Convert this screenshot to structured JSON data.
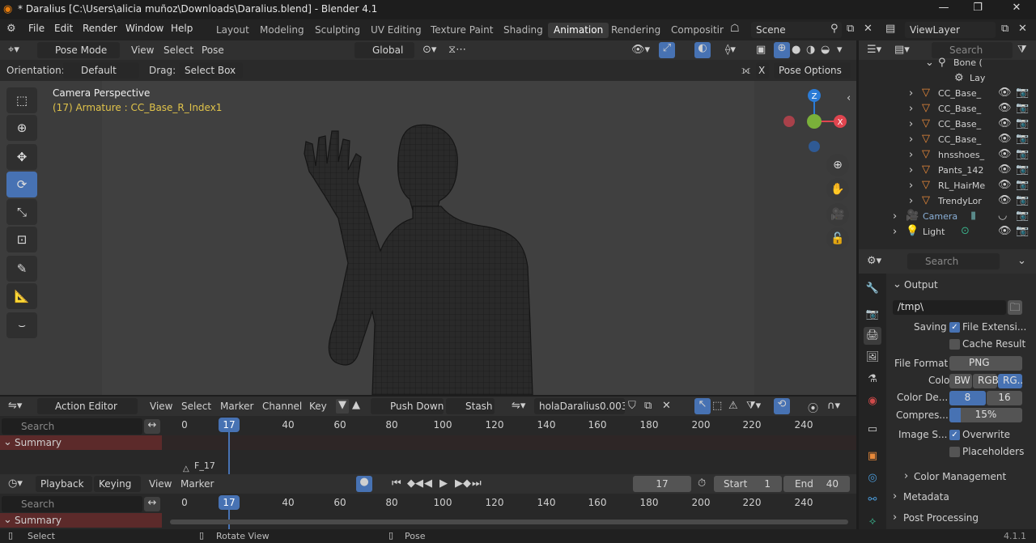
{
  "window": {
    "title": "* Daralius [C:\\Users\\alicia muñoz\\Downloads\\Daralius.blend] - Blender 4.1",
    "minimize": "—",
    "maximize": "❐",
    "close": "✕"
  },
  "menu": {
    "items": [
      "File",
      "Edit",
      "Render",
      "Window",
      "Help"
    ]
  },
  "workspaces": [
    "Layout",
    "Modeling",
    "Sculpting",
    "UV Editing",
    "Texture Paint",
    "Shading",
    "Animation",
    "Rendering",
    "Compositin"
  ],
  "active_workspace": "Animation",
  "scene": {
    "name": "Scene",
    "view_layer": "ViewLayer"
  },
  "viewport_header": {
    "mode": "Pose Mode",
    "view": "View",
    "select": "Select",
    "pose": "Pose",
    "transform": "Global"
  },
  "tool_header": {
    "orientation_label": "Orientation:",
    "orientation_value": "Default",
    "drag_label": "Drag:",
    "drag_value": "Select Box",
    "x_label": "X",
    "pose_options": "Pose Options"
  },
  "viewport": {
    "camera_label": "Camera Perspective",
    "armature_info": "(17) Armature : CC_Base_R_Index1"
  },
  "gizmo": {
    "z": "Z",
    "x": "X"
  },
  "outliner": {
    "search_placeholder": "Search",
    "items": [
      {
        "label": "Bone (",
        "kind": "bone"
      },
      {
        "label": "Lay",
        "kind": "layer"
      },
      {
        "label": "CC_Base_",
        "kind": "mesh"
      },
      {
        "label": "CC_Base_",
        "kind": "mesh"
      },
      {
        "label": "CC_Base_",
        "kind": "mesh"
      },
      {
        "label": "CC_Base_",
        "kind": "mesh"
      },
      {
        "label": "hnsshoes_",
        "kind": "mesh"
      },
      {
        "label": "Pants_142",
        "kind": "mesh"
      },
      {
        "label": "RL_HairMe",
        "kind": "mesh"
      },
      {
        "label": "TrendyLor",
        "kind": "mesh"
      },
      {
        "label": "Camera",
        "kind": "camera"
      },
      {
        "label": "Light",
        "kind": "light"
      }
    ]
  },
  "properties": {
    "search_placeholder": "Search",
    "output_panel": "Output",
    "path": "/tmp\\",
    "saving_label": "Saving",
    "file_extension": "File Extensi...",
    "cache_result": "Cache Result",
    "file_format_label": "File Format",
    "file_format": "PNG",
    "color_label": "Color",
    "color_options": [
      "BW",
      "RGB",
      "RG..."
    ],
    "color_depth_label": "Color De...",
    "color_depth_options": [
      "8",
      "16"
    ],
    "compression_label": "Compres...",
    "compression": "15%",
    "compression_fraction": 0.15,
    "image_seq_label": "Image S...",
    "overwrite": "Overwrite",
    "placeholders": "Placeholders",
    "color_management": "Color Management",
    "metadata": "Metadata",
    "post_processing": "Post Processing"
  },
  "action_editor": {
    "mode": "Action Editor",
    "menus": [
      "View",
      "Select",
      "Marker",
      "Channel",
      "Key"
    ],
    "push_down": "Push Down",
    "stash": "Stash",
    "action_name": "holaDaralius0.003",
    "search_placeholder": "Search",
    "summary": "Summary",
    "marker": "F_17",
    "current_frame": "17",
    "ticks": [
      "0",
      "40",
      "60",
      "80",
      "100",
      "120",
      "140",
      "160",
      "180",
      "200",
      "220",
      "240"
    ]
  },
  "timeline": {
    "menus": [
      "Playback",
      "Keying",
      "View",
      "Marker"
    ],
    "current_frame": "17",
    "start_label": "Start",
    "start": "1",
    "end_label": "End",
    "end": "40",
    "search_placeholder": "Search",
    "summary": "Summary",
    "ticks": [
      "0",
      "40",
      "60",
      "80",
      "100",
      "120",
      "140",
      "160",
      "180",
      "200",
      "220",
      "240"
    ]
  },
  "statusbar": {
    "select": "Select",
    "rotate": "Rotate View",
    "pose": "Pose",
    "version": "4.1.1"
  },
  "colors": {
    "accent": "#4772b3",
    "summary_bg": "#5c2a2a",
    "armature_text": "#e0c34a",
    "mesh_icon": "#e8893a"
  }
}
